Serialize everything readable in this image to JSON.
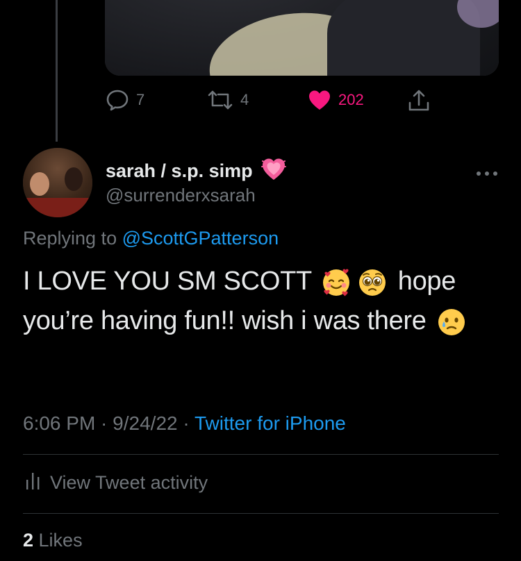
{
  "parent_tweet": {
    "actions": {
      "reply_count": "7",
      "retweet_count": "4",
      "like_count": "202"
    }
  },
  "tweet": {
    "display_name": "sarah / s.p. simp",
    "name_emoji": "growing-heart",
    "handle": "@surrenderxsarah",
    "replying_prefix": "Replying to ",
    "replying_to": "@ScottGPatterson",
    "text_part1": "I LOVE YOU SM SCOTT ",
    "text_part2": " hope you’re having fun!! wish i was there ",
    "emojis": [
      "smiling-face-with-hearts",
      "pleading-face",
      "sad-but-relieved-face"
    ],
    "time": "6:06 PM",
    "separator": " · ",
    "date": "9/24/22",
    "source": "Twitter for iPhone"
  },
  "activity": {
    "label": "View Tweet activity"
  },
  "likes": {
    "count": "2",
    "label": " Likes"
  },
  "colors": {
    "background": "#000000",
    "text": "#e7e9ea",
    "secondary": "#71767b",
    "link": "#1d9bf0",
    "like": "#f91880",
    "divider": "#2f3336"
  }
}
